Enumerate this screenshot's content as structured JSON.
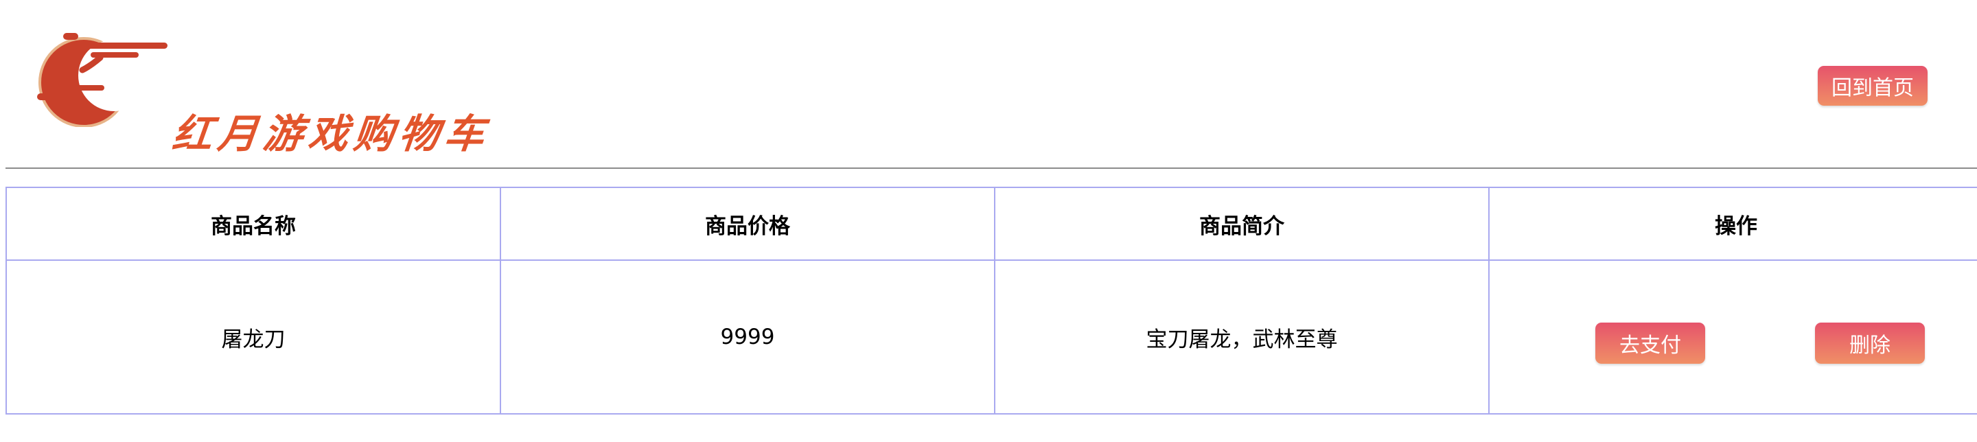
{
  "header": {
    "brand_title": "红月游戏购物车",
    "home_button_label": "回到首页",
    "logo_icon": "red-moon-cloud-logo-icon"
  },
  "colors": {
    "brand": "#e2552c",
    "button_gradient_top": "#e6536b",
    "button_gradient_bottom": "#f08f66",
    "table_border": "#a9a9f0",
    "divider": "#8c8c8c"
  },
  "cart_table": {
    "columns": [
      "商品名称",
      "商品价格",
      "商品简介",
      "操作"
    ],
    "rows": [
      {
        "name": "屠龙刀",
        "price": "9999",
        "description": "宝刀屠龙，武林至尊",
        "pay_label": "去支付",
        "delete_label": "删除"
      }
    ]
  }
}
